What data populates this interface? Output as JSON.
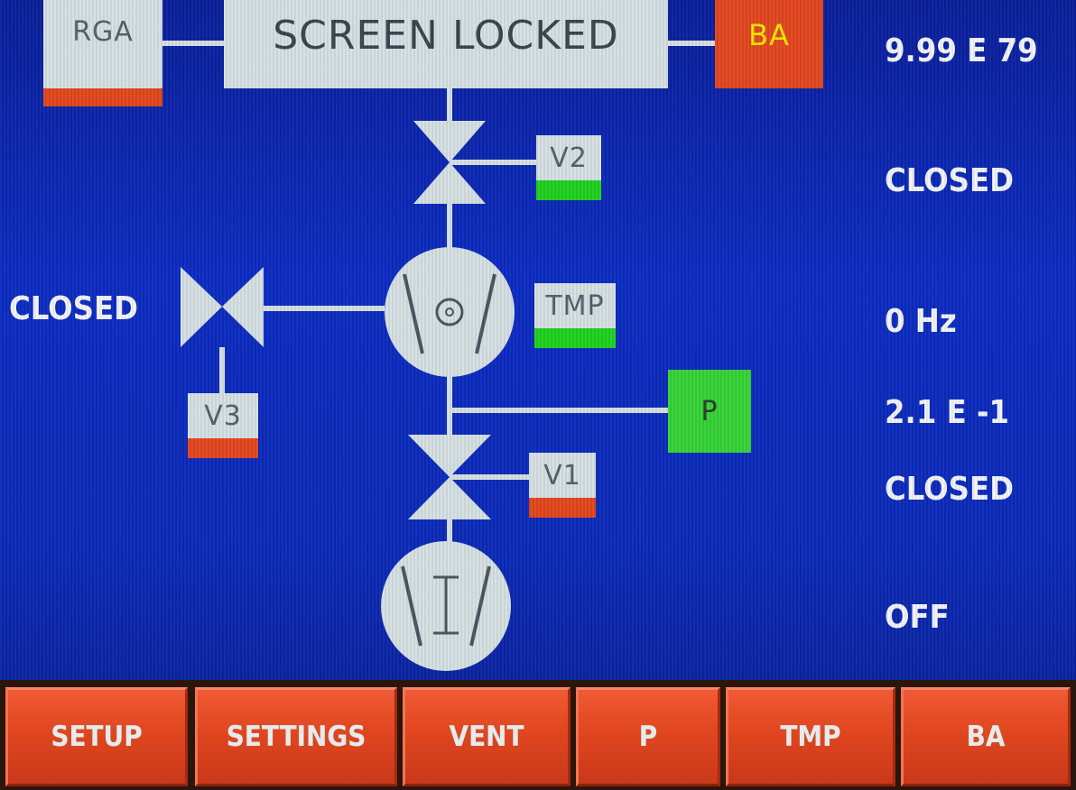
{
  "header": {
    "rga_label": "RGA",
    "title": "SCREEN LOCKED",
    "ba_label": "BA"
  },
  "diagram": {
    "v1_label": "V1",
    "v2_label": "V2",
    "v3_label": "V3",
    "tmp_label": "TMP",
    "p_label": "P",
    "v3_state": "CLOSED"
  },
  "readouts": {
    "pressure_ba": "9.99 E  79",
    "v2_state": "CLOSED",
    "tmp_frequency": "0 Hz",
    "pressure_p": "2.1 E  -1",
    "v1_state": "CLOSED",
    "backing_pump_state": "OFF"
  },
  "buttons": [
    {
      "label": "SETUP"
    },
    {
      "label": "SETTINGS"
    },
    {
      "label": "VENT"
    },
    {
      "label": "P"
    },
    {
      "label": "TMP"
    },
    {
      "label": "BA"
    }
  ],
  "colors": {
    "background": "#0c2cc2",
    "status_ok": "#1fd11f",
    "status_off": "#e2471e",
    "button": "#e0461f",
    "ba_text": "#f2e600",
    "symbol": "#d6e0e3"
  },
  "icons": {
    "valve": "valve-icon",
    "turbo_pump": "turbo-pump-icon",
    "backing_pump": "backing-pump-icon"
  }
}
